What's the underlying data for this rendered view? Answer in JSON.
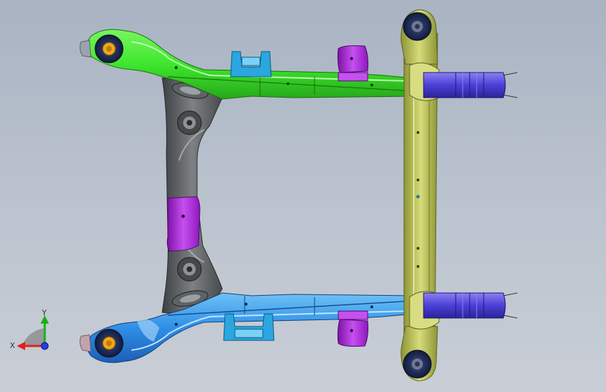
{
  "viewport": {
    "background_top": "#a9b3c2",
    "background_bottom": "#c9ced6"
  },
  "model": {
    "parts": [
      {
        "name": "front-crossmember",
        "color": "#b9c24e"
      },
      {
        "name": "left-longitudinal-rail",
        "color": "#3fe62e"
      },
      {
        "name": "right-longitudinal-rail",
        "color": "#2f8fe8"
      },
      {
        "name": "rear-crossmember",
        "color": "#5a5d5e"
      },
      {
        "name": "bracket",
        "color": "#a11fd0"
      },
      {
        "name": "mount-clip",
        "color": "#2aa6e0"
      },
      {
        "name": "tube-extension",
        "color": "#4b3fd6"
      },
      {
        "name": "bushing",
        "color": "#1e2a55"
      },
      {
        "name": "bushing-core",
        "color": "#f0a818"
      }
    ]
  },
  "triad": {
    "x_label": "X",
    "y_label": "Y",
    "x_color": "#e02020",
    "y_color": "#18b018",
    "z_color": "#2040e0"
  }
}
